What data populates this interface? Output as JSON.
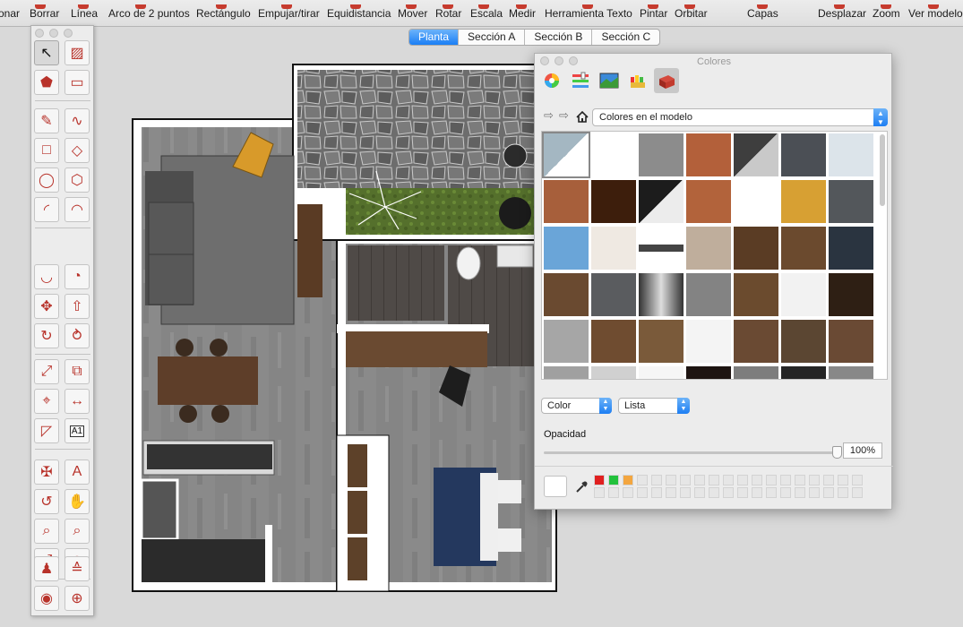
{
  "toolbar": {
    "items": [
      "onar",
      "Borrar",
      "Línea",
      "Arco de 2 puntos",
      "Rectángulo",
      "Empujar/tirar",
      "Equidistancia",
      "Mover",
      "Rotar",
      "Escala",
      "Medir",
      "Herramienta Texto",
      "Pintar",
      "Orbitar",
      "Capas",
      "Desplazar",
      "Zoom",
      "Ver modelo"
    ]
  },
  "scene_tabs": [
    {
      "label": "Planta",
      "active": true
    },
    {
      "label": "Sección A",
      "active": false
    },
    {
      "label": "Sección B",
      "active": false
    },
    {
      "label": "Sección C",
      "active": false
    }
  ],
  "tool_palette": {
    "icons": [
      "select-arrow-icon",
      "eraser-box-icon",
      "paint-bucket-icon",
      "eraser-icon",
      "pencil-icon",
      "freehand-icon",
      "rectangle-icon",
      "rotated-rectangle-icon",
      "circle-icon",
      "polygon-icon",
      "arc-icon",
      "two-point-arc-icon",
      "three-point-arc-icon",
      "pie-icon",
      "move-icon",
      "push-pull-icon",
      "rotate-icon",
      "follow-me-icon",
      "scale-icon",
      "offset-icon",
      "tape-measure-icon",
      "dimension-icon",
      "protractor-icon",
      "text-icon",
      "axes-icon",
      "3d-text-icon",
      "orbit-icon",
      "pan-icon",
      "zoom-icon",
      "zoom-window-icon",
      "zoom-extents-icon",
      "previous-view-icon",
      "position-camera-icon",
      "walk-icon",
      "look-around-icon",
      "section-plane-icon"
    ],
    "text_tool_label": "A1"
  },
  "colors_panel": {
    "title": "Colores",
    "mode_tabs": [
      "color-wheel-icon",
      "color-sliders-icon",
      "image-palette-icon",
      "crayons-icon",
      "materials-brick-icon"
    ],
    "collection": "Colores en el modelo",
    "color_mode": "Color",
    "view_mode": "Lista",
    "opacity_label": "Opacidad",
    "opacity_value": "100%",
    "opacity": 1.0,
    "swatches": [
      [
        "#a4b7c2",
        "#ffffff",
        "#8c8c8c",
        "#b3603a",
        "#8f8f8f",
        "#4b4f55",
        "#dce4ea"
      ],
      [
        "#a75f3b",
        "#3d1e0c",
        "#ececec",
        "#b2633b",
        "#ffffff",
        "#d7a033",
        "#53575b"
      ],
      [
        "#6aa5d8",
        "#efe9e2",
        "#ededed",
        "#bfae9c",
        "#5a3c24",
        "#6b4a2e",
        "#2a3440"
      ],
      [
        "#6a4a30",
        "#5a5c5f",
        "#888888",
        "#838383",
        "#6b4b2e",
        "#f2f2f2",
        "#2e1f14"
      ],
      [
        "#a6a6a6",
        "#6f4c30",
        "#7a5a3a",
        "#f4f4f4",
        "#6a4a33",
        "#5b4632",
        "#6a4a34"
      ],
      [
        "#a0a0a0",
        "#d0d0d0",
        "#f6f6f6",
        "#1e1512",
        "#7d7d7d",
        "#252525",
        "#888888"
      ]
    ],
    "recent_colors": [
      "#e02020",
      "#22c13c",
      "#f3a640"
    ]
  }
}
